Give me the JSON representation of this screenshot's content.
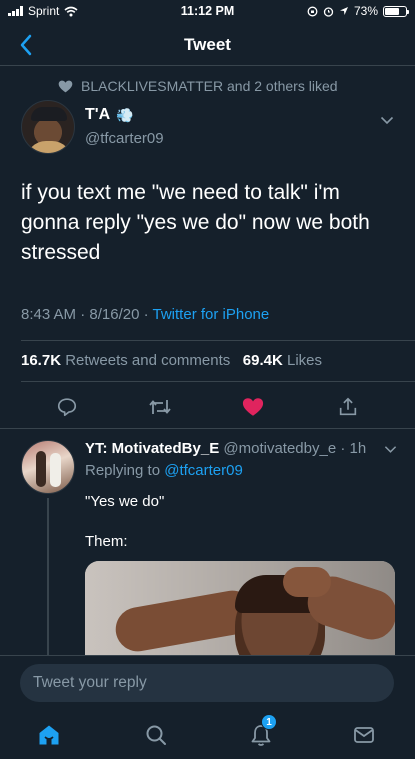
{
  "status_bar": {
    "carrier": "Sprint",
    "time": "11:12 PM",
    "battery": "73%"
  },
  "nav": {
    "title": "Tweet",
    "back_icon": "chevron-left-icon"
  },
  "social_context": {
    "icon": "heart-icon",
    "text": "BLACKLIVESMATTER and 2 others liked"
  },
  "tweet": {
    "author_name": "T'A",
    "author_emoji": "💨",
    "handle": "@tfcarter09",
    "text": "if you text me \"we need to talk\" i'm gonna reply \"yes we do\" now we both stressed",
    "time": "8:43 AM",
    "date": "8/16/20",
    "source": "Twitter for iPhone",
    "retweets_count": "16.7K",
    "retweets_label": "Retweets and comments",
    "likes_count": "69.4K",
    "likes_label": "Likes"
  },
  "actions": [
    "reply-icon",
    "retweet-icon",
    "like-icon",
    "share-icon"
  ],
  "reply": {
    "author_name": "YT: MotivatedBy_E",
    "handle": "@motivatedby_e",
    "age": "1h",
    "replying_prefix": "Replying to",
    "replying_to": "@tfcarter09",
    "line1": "\"Yes we do\"",
    "line2": "Them:"
  },
  "composer": {
    "placeholder": "Tweet your reply"
  },
  "tabbar": {
    "tabs": [
      "home-icon",
      "search-icon",
      "notifications-icon",
      "messages-icon"
    ],
    "notifications_badge": "1"
  },
  "colors": {
    "background": "#15202b",
    "accent": "#1da1f2",
    "muted": "#8899a6",
    "like": "#e0245e"
  }
}
